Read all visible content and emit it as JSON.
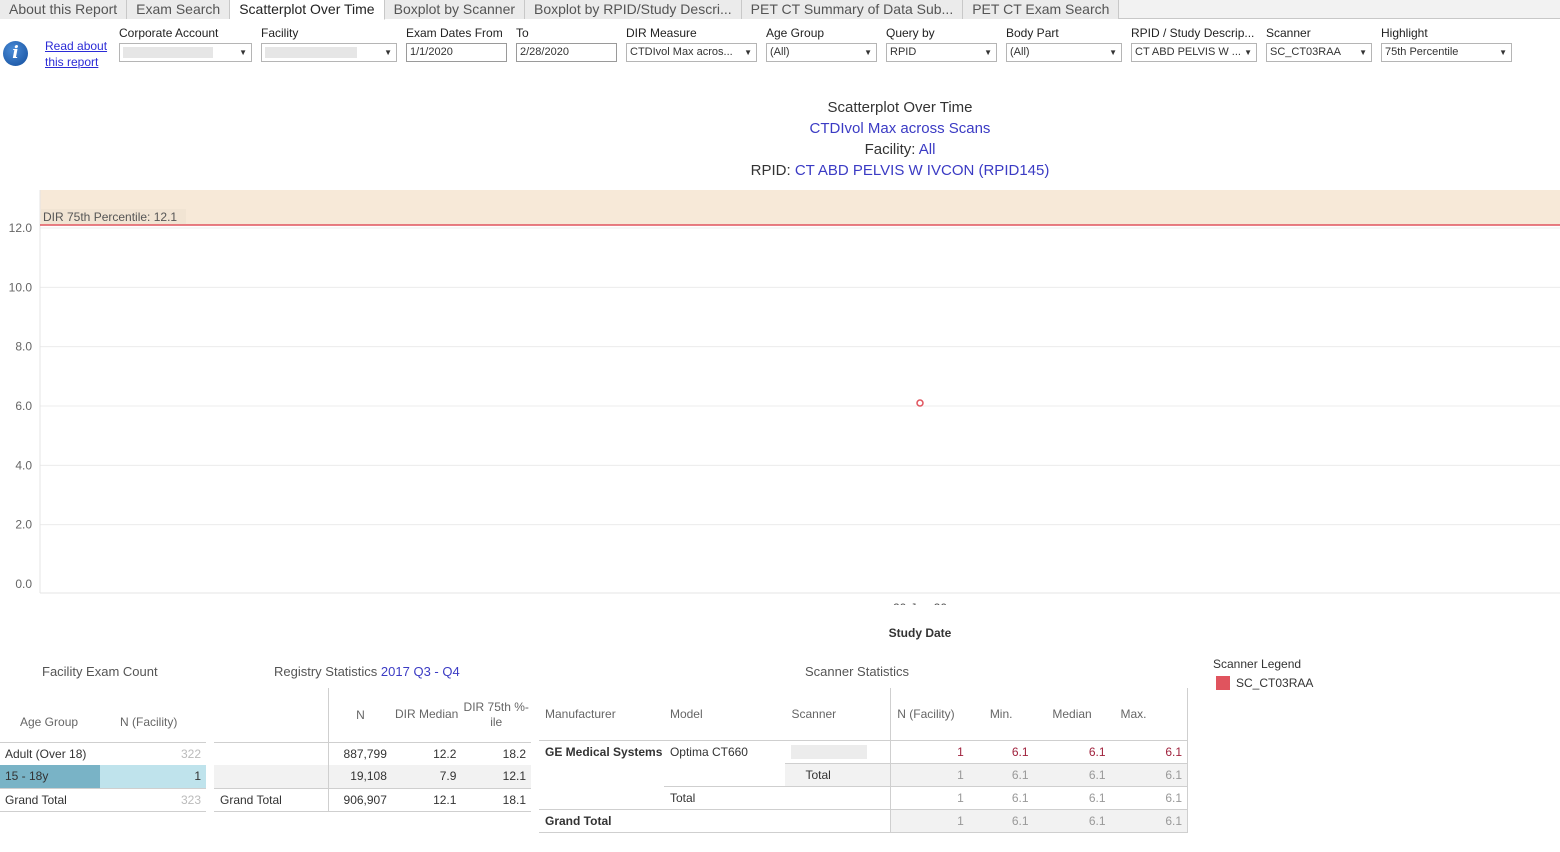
{
  "tabs": [
    "About this Report",
    "Exam Search",
    "Scatterplot Over Time",
    "Boxplot by Scanner",
    "Boxplot by RPID/Study Descri...",
    "PET CT Summary of Data Sub...",
    "PET CT Exam Search"
  ],
  "active_tab": 2,
  "read_link": "Read about this report",
  "filters": {
    "corporate_account": {
      "label": "Corporate Account",
      "value": ""
    },
    "facility": {
      "label": "Facility",
      "value": ""
    },
    "exam_dates_from": {
      "label": "Exam Dates From",
      "value": "1/1/2020"
    },
    "to": {
      "label": "To",
      "value": "2/28/2020"
    },
    "dir_measure": {
      "label": "DIR Measure",
      "value": "CTDIvol Max acros..."
    },
    "age_group": {
      "label": "Age Group",
      "value": "(All)"
    },
    "query_by": {
      "label": "Query by",
      "value": "RPID"
    },
    "body_part": {
      "label": "Body Part",
      "value": "(All)"
    },
    "rpid_study": {
      "label": "RPID / Study Descrip...",
      "value": "CT ABD PELVIS W ..."
    },
    "scanner": {
      "label": "Scanner",
      "value": "SC_CT03RAA"
    },
    "highlight": {
      "label": "Highlight",
      "value": "75th Percentile"
    }
  },
  "chart_title": {
    "line1": "Scatterplot Over Time",
    "line2": "CTDIvol Max across Scans",
    "line3_prefix": "Facility: ",
    "line3_value": "All",
    "line4_prefix": "RPID: ",
    "line4_value": "CT ABD PELVIS W IVCON (RPID145)"
  },
  "chart_data": {
    "type": "scatter",
    "xlabel": "Study Date",
    "ylabel": "",
    "ylim": [
      0,
      13.1
    ],
    "yticks": [
      0,
      2,
      4,
      6,
      8,
      10,
      12
    ],
    "ytick_labels": [
      "0.0",
      "2.0",
      "4.0",
      "6.0",
      "8.0",
      "10.0",
      "12.0"
    ],
    "xtick_labels": [
      "20-Jan-20"
    ],
    "series": [
      {
        "name": "SC_CT03RAA",
        "color": "#e0545e",
        "points": [
          {
            "x": "20-Jan-20",
            "y": 6.1
          }
        ]
      }
    ],
    "reference_line": {
      "label": "DIR 75th Percentile: 12.1",
      "value": 12.1,
      "color": "#e0545e",
      "band_color": "#f7e9d8"
    },
    "grid": true
  },
  "facility_exam_count": {
    "title": "Facility Exam Count",
    "headers": [
      "Age Group",
      "N (Facility)"
    ],
    "rows": [
      {
        "group": "Adult (Over 18)",
        "n": "322"
      },
      {
        "group": "15 - 18y",
        "n": "1"
      },
      {
        "group": "Grand Total",
        "n": "323"
      }
    ]
  },
  "registry_stats": {
    "title_prefix": "Registry Statistics ",
    "title_period": "2017 Q3 - Q4",
    "headers": [
      "N",
      "DIR Median",
      "DIR 75th %-ile"
    ],
    "rows": [
      {
        "label": "",
        "n": "887,799",
        "median": "12.2",
        "p75": "18.2"
      },
      {
        "label": "",
        "n": "19,108",
        "median": "7.9",
        "p75": "12.1"
      },
      {
        "label": "Grand Total",
        "n": "906,907",
        "median": "12.1",
        "p75": "18.1"
      }
    ]
  },
  "scanner_stats": {
    "title": "Scanner Statistics",
    "headers": [
      "Manufacturer",
      "Model",
      "Scanner",
      "N (Facility)",
      "Min.",
      "Median",
      "Max."
    ],
    "manufacturer": "GE Medical Systems",
    "model": "Optima CT660",
    "row_main": {
      "n": "1",
      "min": "6.1",
      "median": "6.1",
      "max": "6.1"
    },
    "row_scanner_total": {
      "label": "Total",
      "n": "1",
      "min": "6.1",
      "median": "6.1",
      "max": "6.1"
    },
    "row_model_total": {
      "label": "Total",
      "n": "1",
      "min": "6.1",
      "median": "6.1",
      "max": "6.1"
    },
    "row_grand_total": {
      "label": "Grand Total",
      "n": "1",
      "min": "6.1",
      "median": "6.1",
      "max": "6.1"
    }
  },
  "scanner_legend": {
    "title": "Scanner Legend",
    "items": [
      {
        "label": "SC_CT03RAA",
        "color": "#e0545e"
      }
    ]
  }
}
